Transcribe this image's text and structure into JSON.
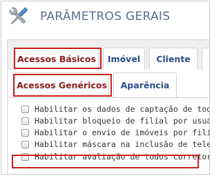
{
  "header": {
    "title": "PARÂMETROS GERAIS",
    "icon": "tools-icon"
  },
  "tabs_primary": [
    {
      "label": "Acessos Básicos",
      "active": true
    },
    {
      "label": "Imóvel",
      "active": false
    },
    {
      "label": "Cliente",
      "active": false
    }
  ],
  "tabs_secondary": [
    {
      "label": "Acessos Genéricos",
      "active": true
    },
    {
      "label": "Aparência",
      "active": false
    }
  ],
  "options": [
    {
      "label": "Habilitar os dados de captação de todos os",
      "checked": false
    },
    {
      "label": "Habilitar bloqueio de filial por usuário.",
      "checked": false
    },
    {
      "label": "Habilitar o envio de imóveis por filial.",
      "checked": false
    },
    {
      "label": "Habilitar máscara na inclusão de telefone.",
      "checked": false
    },
    {
      "label": "Habilitar avaliação de todos corretores.",
      "checked": false
    }
  ],
  "colors": {
    "title": "#5b6f8e",
    "tab_text": "#2a4d8a",
    "highlight": "#d01f1f"
  }
}
